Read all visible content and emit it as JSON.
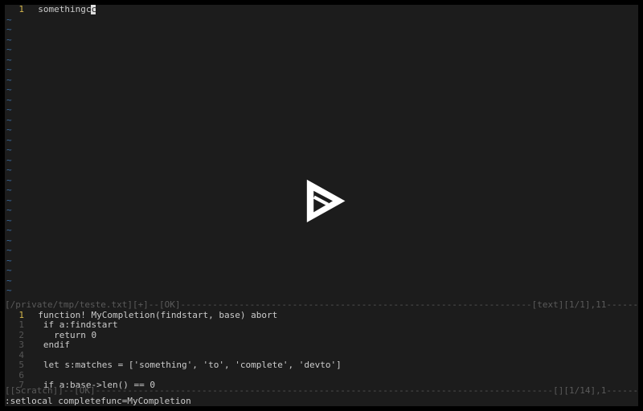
{
  "top_pane": {
    "lines": [
      {
        "n": "1",
        "text": "somethingc",
        "cursor_char": "c"
      }
    ],
    "tilde_rows": 28
  },
  "status_top": {
    "left": "[/private/tmp/teste.txt][+]--[OK]",
    "right": "[text][1/1],11------"
  },
  "bottom_pane": {
    "current_line": {
      "n": "1",
      "text": "function! MyCompletion(findstart, base) abort"
    },
    "lines": [
      {
        "n": "1",
        "text": " if a:findstart"
      },
      {
        "n": "2",
        "text": "   return 0"
      },
      {
        "n": "3",
        "text": " endif"
      },
      {
        "n": "4",
        "text": ""
      },
      {
        "n": "5",
        "text": " let s:matches = ['something', 'to', 'complete', 'devto']"
      },
      {
        "n": "6",
        "text": ""
      },
      {
        "n": "7",
        "text": " if a:base->len() == 0"
      }
    ]
  },
  "status_bottom": {
    "left": "[[Scratch]]--[OK]",
    "right": "[][1/14],1------"
  },
  "command_line": ":setlocal completefunc=MyCompletion",
  "overlay": {
    "icon_name": "play-icon"
  }
}
